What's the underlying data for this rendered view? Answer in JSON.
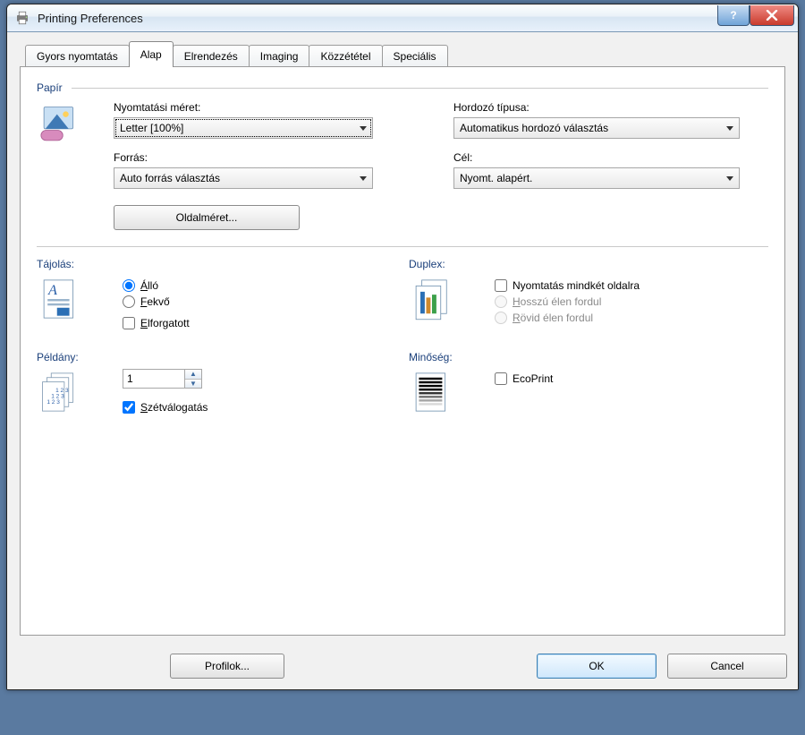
{
  "titlebar": {
    "title": "Printing Preferences"
  },
  "tabs": {
    "t0": "Gyors nyomtatás",
    "t1": "Alap",
    "t2": "Elrendezés",
    "t3": "Imaging",
    "t4": "Közzététel",
    "t5": "Speciális",
    "active_index": 1
  },
  "paper": {
    "group": "Papír",
    "size_label": "Nyomtatási méret:",
    "size_value": "Letter  [100%]",
    "media_label": "Hordozó típusa:",
    "media_value": "Automatikus hordozó választás",
    "source_label": "Forrás:",
    "source_value": "Auto forrás választás",
    "dest_label": "Cél:",
    "dest_value": "Nyomt. alapért.",
    "pagesize_btn": "Oldalméret..."
  },
  "orientation": {
    "title": "Tájolás:",
    "portrait_u": "Á",
    "portrait_rest": "lló",
    "landscape_u": "F",
    "landscape_rest": "ekvő",
    "rotated_u": "E",
    "rotated_rest": "lforgatott",
    "selected": "portrait",
    "rotated_checked": false
  },
  "duplex": {
    "title": "Duplex:",
    "both_sides": "Nyomtatás mindkét oldalra",
    "long_edge_u": "H",
    "long_edge_rest": "osszú élen fordul",
    "short_edge_u": "R",
    "short_edge_rest": "övid élen fordul",
    "both_sides_checked": false
  },
  "copies": {
    "title": "Példány:",
    "value": "1",
    "collate_u": "S",
    "collate_rest": "zétválogatás",
    "collate_checked": true
  },
  "quality": {
    "title": "Minőség:",
    "ecoprint": "EcoPrint",
    "ecoprint_checked": false
  },
  "footer": {
    "profiles": "Profilok...",
    "ok": "OK",
    "cancel": "Cancel"
  }
}
